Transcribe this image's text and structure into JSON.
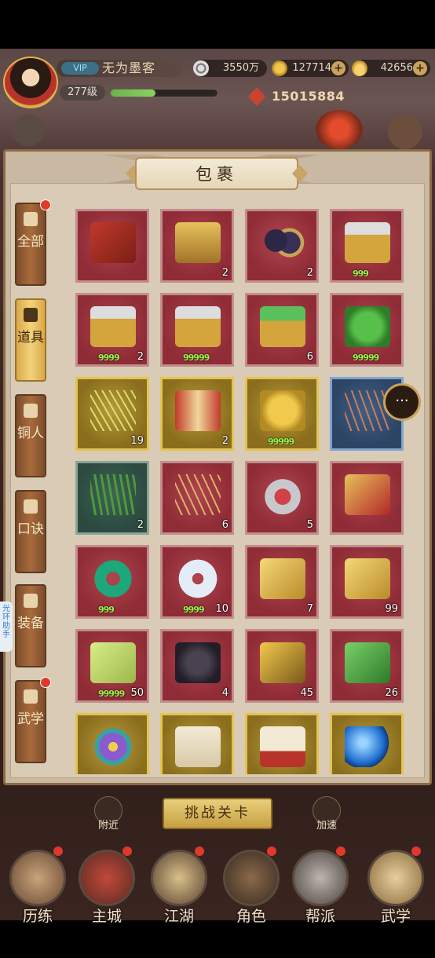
{
  "player": {
    "vip_label": "VIP",
    "name": "无为墨客",
    "level": "277级",
    "exp_fraction": 0.42,
    "power": "15015884"
  },
  "currencies": [
    {
      "name": "silver",
      "icon": "coin-icon",
      "value": "3550万"
    },
    {
      "name": "gold",
      "icon": "gold-ingot-icon",
      "value": "127714"
    },
    {
      "name": "yuanbao",
      "icon": "yuanbao-icon",
      "value": "42656"
    }
  ],
  "panel": {
    "title": "包裹"
  },
  "tabs": [
    {
      "label": "全部",
      "active": false,
      "dot": true,
      "icon": "fan-icon"
    },
    {
      "label": "道具",
      "active": true,
      "dot": false,
      "icon": "pouch-icon"
    },
    {
      "label": "铜人",
      "active": false,
      "dot": false,
      "icon": "bronze-man-icon"
    },
    {
      "label": "口诀",
      "active": false,
      "dot": false,
      "icon": "scroll-icon"
    },
    {
      "label": "装备",
      "active": false,
      "dot": false,
      "icon": "armor-icon"
    },
    {
      "label": "武学",
      "active": false,
      "dot": true,
      "icon": "manual-icon"
    }
  ],
  "assist_label": "光环助手",
  "items": [
    {
      "rarity": "red",
      "icon": "red-envelope-icon",
      "count": "",
      "level": ""
    },
    {
      "rarity": "red",
      "icon": "treasure-box-icon",
      "count": "2",
      "level": ""
    },
    {
      "rarity": "red",
      "icon": "dark-orbs-icon",
      "count": "2",
      "level": ""
    },
    {
      "rarity": "red",
      "icon": "weapon-chest-icon",
      "count": "",
      "level": "999"
    },
    {
      "rarity": "red",
      "icon": "weapon-chest-icon",
      "count": "2",
      "level": "9999"
    },
    {
      "rarity": "red",
      "icon": "weapon-chest-icon",
      "count": "",
      "level": "99999"
    },
    {
      "rarity": "red",
      "icon": "jade-box-icon",
      "count": "6",
      "level": ""
    },
    {
      "rarity": "red",
      "icon": "wu-token-icon",
      "count": "",
      "level": "99999"
    },
    {
      "rarity": "gold",
      "icon": "needles-icon",
      "count": "19",
      "level": ""
    },
    {
      "rarity": "gold",
      "icon": "book-stack-icon",
      "count": "2",
      "level": ""
    },
    {
      "rarity": "gold",
      "icon": "te-token-icon",
      "count": "",
      "level": "99999"
    },
    {
      "rarity": "blue",
      "icon": "arrows-icon",
      "count": "",
      "level": ""
    },
    {
      "rarity": "green",
      "icon": "herb-bundle-icon",
      "count": "2",
      "level": ""
    },
    {
      "rarity": "red",
      "icon": "hairpins-icon",
      "count": "6",
      "level": ""
    },
    {
      "rarity": "red",
      "icon": "rouge-box-icon",
      "count": "5",
      "level": ""
    },
    {
      "rarity": "red",
      "icon": "shang-token-icon",
      "count": "",
      "level": ""
    },
    {
      "rarity": "red",
      "icon": "jade-ring-icon",
      "count": "",
      "level": "999"
    },
    {
      "rarity": "red",
      "icon": "cloud-jade-icon",
      "count": "10",
      "level": "9999"
    },
    {
      "rarity": "red",
      "icon": "gold-ore-icon",
      "count": "7",
      "level": ""
    },
    {
      "rarity": "red",
      "icon": "gold-ore-icon",
      "count": "99",
      "level": ""
    },
    {
      "rarity": "red",
      "icon": "jade-tablet-icon",
      "count": "50",
      "level": "99999"
    },
    {
      "rarity": "red",
      "icon": "dark-disc-icon",
      "count": "4",
      "level": ""
    },
    {
      "rarity": "red",
      "icon": "te-stone-icon",
      "count": "45",
      "level": ""
    },
    {
      "rarity": "red",
      "icon": "wu-stone-icon",
      "count": "26",
      "level": ""
    },
    {
      "rarity": "gold",
      "icon": "flower-icon",
      "count": "",
      "level": ""
    },
    {
      "rarity": "gold",
      "icon": "qianji-scroll-icon",
      "count": "",
      "level": ""
    },
    {
      "rarity": "gold",
      "icon": "qianji-box-icon",
      "count": "",
      "level": ""
    },
    {
      "rarity": "gold",
      "icon": "blue-orb-icon",
      "count": "",
      "level": ""
    }
  ],
  "challenge_button": "挑战关卡",
  "nearby_label": "附近",
  "speedup_label": "加速",
  "bottom_nav": [
    {
      "label": "历练",
      "dot": true
    },
    {
      "label": "主城",
      "dot": true
    },
    {
      "label": "江湖",
      "dot": true
    },
    {
      "label": "角色",
      "dot": true
    },
    {
      "label": "帮派",
      "dot": true
    },
    {
      "label": "武学",
      "dot": true
    }
  ],
  "colors": {
    "accent": "#d9a84a",
    "red_slot": "#9b3540",
    "gold_slot": "#a0842a",
    "badge_red": "#e0392b"
  }
}
